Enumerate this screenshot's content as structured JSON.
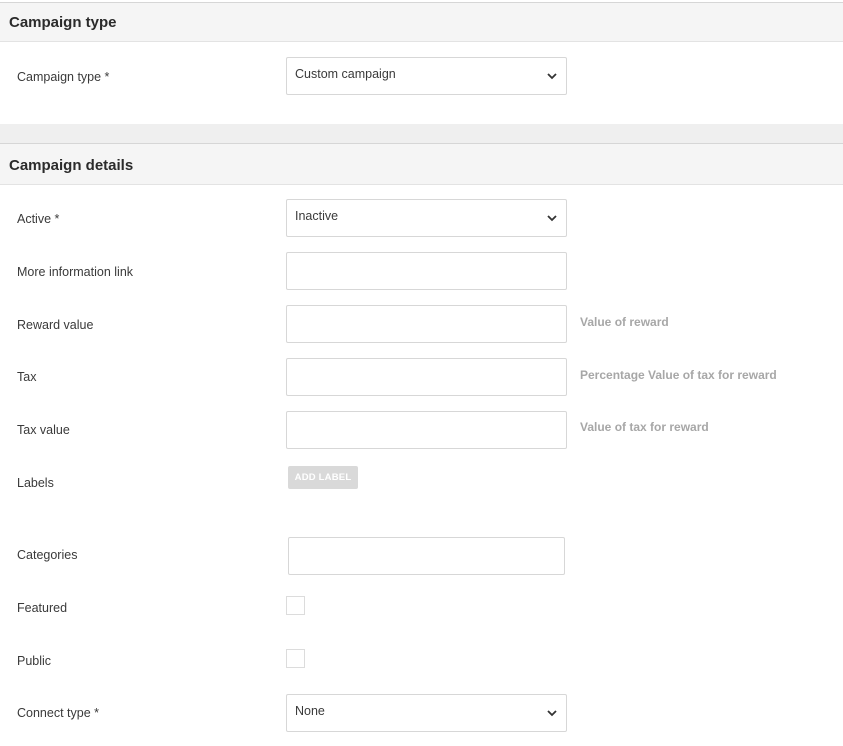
{
  "sections": {
    "campaign_type": {
      "title": "Campaign type"
    },
    "campaign_details": {
      "title": "Campaign details"
    }
  },
  "fields": {
    "campaign_type": {
      "label": "Campaign type *",
      "value": "Custom campaign"
    },
    "active": {
      "label": "Active *",
      "value": "Inactive"
    },
    "more_info_link": {
      "label": "More information link",
      "value": ""
    },
    "reward_value": {
      "label": "Reward value",
      "value": "",
      "hint": "Value of reward"
    },
    "tax": {
      "label": "Tax",
      "value": "",
      "hint": "Percentage Value of tax for reward"
    },
    "tax_value": {
      "label": "Tax value",
      "value": "",
      "hint": "Value of tax for reward"
    },
    "labels": {
      "label": "Labels",
      "button": "ADD LABEL"
    },
    "categories": {
      "label": "Categories",
      "value": ""
    },
    "featured": {
      "label": "Featured",
      "checked": false
    },
    "public": {
      "label": "Public",
      "checked": false
    },
    "connect_type": {
      "label": "Connect type *",
      "value": "None"
    }
  },
  "icons": {
    "select_chevron": "chevron-down-icon"
  },
  "colors": {
    "hint_text": "#a7a7a7",
    "section_bg": "#f5f5f5",
    "button_bg": "#d9d9d9"
  }
}
